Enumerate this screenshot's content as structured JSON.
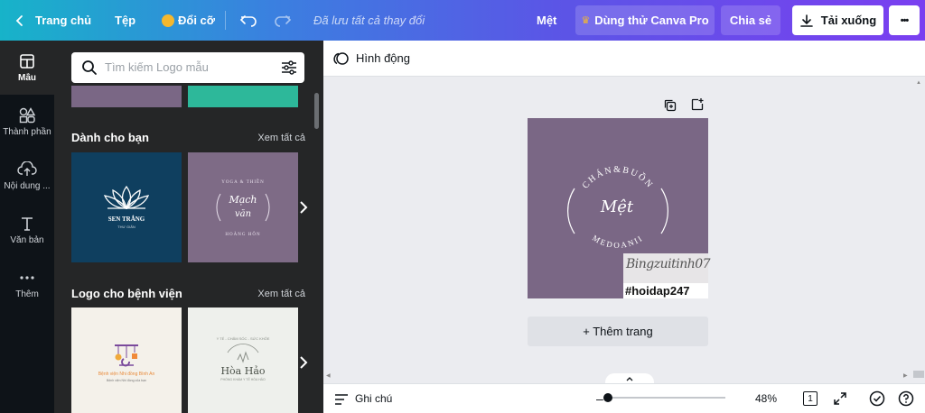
{
  "topbar": {
    "home": "Trang chủ",
    "file": "Tệp",
    "resize": "Đổi cỡ",
    "saved_status": "Đã lưu tất cả thay đổi",
    "design_name": "Mệt",
    "try_pro": "Dùng thử Canva Pro",
    "share": "Chia sẻ",
    "download": "Tải xuống",
    "more": "•••"
  },
  "rail": {
    "items": [
      {
        "label": "Mẫu",
        "icon": "templates-icon"
      },
      {
        "label": "Thành phần",
        "icon": "elements-icon"
      },
      {
        "label": "Nội dung ...",
        "icon": "upload-icon"
      },
      {
        "label": "Văn bản",
        "icon": "text-icon"
      },
      {
        "label": "Thêm",
        "icon": "more-icon"
      }
    ]
  },
  "panel": {
    "search_placeholder": "Tìm kiếm Logo mẫu",
    "sections": [
      {
        "title": "Dành cho bạn",
        "see_all": "Xem tất cả",
        "thumbs": [
          {
            "title": "SEN TRẮNG",
            "subtitle": "THƯ GIÃN"
          },
          {
            "title": "Mạch",
            "title2": "văn",
            "ring_top": "YOGA & THIỀN",
            "ring_bottom": "HOÀNG HÔN"
          }
        ]
      },
      {
        "title": "Logo cho bệnh viện",
        "see_all": "Xem tất cả",
        "thumbs": [
          {
            "title": "Bệnh viện Nhi đồng Bình An",
            "subtitle": "Bệnh viện Nhi đồng của bạn"
          },
          {
            "title": "Hòa Hảo",
            "subtitle": "PHÒNG KHÁM Y TẾ HÒA HẢO",
            "ring": "Y TẾ - CHĂM SÓC - SỨC KHỎE"
          }
        ]
      }
    ]
  },
  "context_bar": {
    "animate": "Hình động"
  },
  "design": {
    "ring_top": "CHÁN&BUỒN",
    "center": "Mệt",
    "ring_bottom": "MEDOANII",
    "signature": "Bingzuitinh07",
    "watermark": "#hoidap247"
  },
  "add_page": "+ Thêm trang",
  "bottombar": {
    "notes": "Ghi chú",
    "zoom": "48%",
    "page_count": "1"
  },
  "colors": {
    "page_bg": "#7a6785",
    "rail_bg": "#0e1318",
    "panel_bg": "#252627",
    "thumb_navy": "#0f3f5f",
    "thumb_mauve": "#7e6b86"
  }
}
